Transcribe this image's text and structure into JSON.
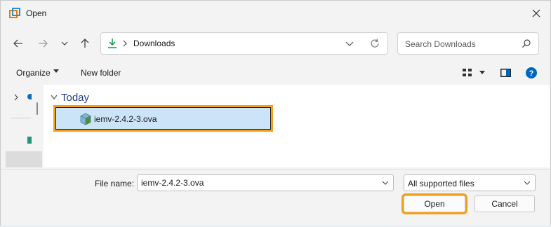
{
  "window": {
    "title": "Open"
  },
  "nav": {
    "address": "Downloads",
    "search_placeholder": "Search Downloads"
  },
  "command_bar": {
    "organize_label": "Organize",
    "new_folder_label": "New folder"
  },
  "content": {
    "groups": [
      {
        "label": "Today",
        "files": [
          {
            "name": "iemv-2.4.2-3.ova",
            "selected": true
          }
        ]
      }
    ]
  },
  "footer": {
    "file_name_label": "File name:",
    "file_name_value": "iemv-2.4.2-3.ova",
    "file_type": "All supported files",
    "open_label": "Open",
    "cancel_label": "Cancel"
  },
  "colors": {
    "highlight": "#f2a11c",
    "selection": "#cce4f7",
    "accent": "#0067c0",
    "group_header": "#1f3f8c"
  },
  "icons": [
    "app-icon",
    "close-icon",
    "back-arrow-icon",
    "forward-arrow-icon",
    "recent-dropdown-icon",
    "up-arrow-icon",
    "download-icon",
    "chevron-right-icon",
    "address-dropdown-icon",
    "refresh-icon",
    "search-icon",
    "view-grid-icon",
    "preview-pane-icon",
    "help-icon",
    "ova-file-icon"
  ]
}
